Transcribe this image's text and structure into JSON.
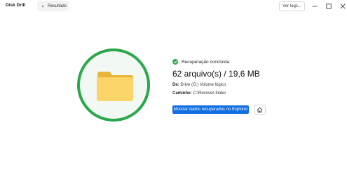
{
  "titlebar": {
    "app_name": "Disk Drill",
    "back_label": "Resultado",
    "logs_label": "Ver logs...",
    "icons": [
      "chevron-left-icon",
      "minimize-icon",
      "maximize-icon",
      "close-icon"
    ]
  },
  "result": {
    "status": "Recuperação concluída",
    "summary": "62 arquivo(s) / 19,6 MB",
    "from_label": "De:",
    "from_value": "Drive (G:) Volume lógico",
    "path_label": "Caminho:",
    "path_value": "C:\\Recover-folder",
    "show_button": "Mostrar dados recuperados no Explorer",
    "icons": [
      "folder-icon",
      "check-circle-icon",
      "home-icon"
    ]
  },
  "colors": {
    "success": "#2aa84a",
    "accent": "#0f6fe0",
    "folder": "#f9c74f"
  }
}
